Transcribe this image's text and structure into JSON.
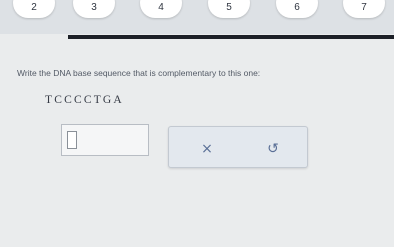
{
  "progress": {
    "steps": [
      {
        "label": "2"
      },
      {
        "label": "3"
      },
      {
        "label": "4"
      },
      {
        "label": "5"
      },
      {
        "label": "6"
      },
      {
        "label": "7"
      }
    ]
  },
  "question": {
    "prompt": "Write the DNA base sequence that is complementary to this one:",
    "sequence": "TCCCCTGA"
  },
  "answer": {
    "value": ""
  },
  "actions": {
    "clear_icon": "x-icon",
    "undo_icon": "undo-icon",
    "clear_glyph": "×",
    "undo_glyph": "↺"
  },
  "colors": {
    "accent": "#5a6f96",
    "rule": "#1c2027",
    "background": "#eaeced"
  }
}
